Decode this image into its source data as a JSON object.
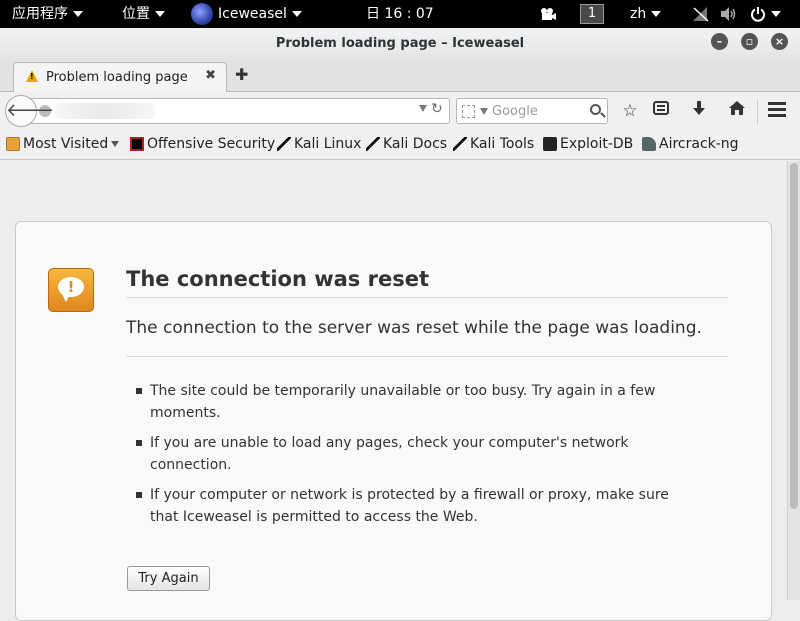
{
  "topbar": {
    "applications": "应用程序",
    "places": "位置",
    "app_name": "Iceweasel",
    "clock": "日 16 : 07",
    "workspace": "1",
    "input_method": "zh"
  },
  "window": {
    "title": "Problem loading page – Iceweasel"
  },
  "tabs": [
    {
      "label": "Problem loading page"
    }
  ],
  "navbar": {
    "search_placeholder": "Google"
  },
  "bookmarks": [
    {
      "label": "Most Visited"
    },
    {
      "label": "Offensive Security"
    },
    {
      "label": "Kali Linux"
    },
    {
      "label": "Kali Docs"
    },
    {
      "label": "Kali Tools"
    },
    {
      "label": "Exploit-DB"
    },
    {
      "label": "Aircrack-ng"
    }
  ],
  "error": {
    "title": "The connection was reset",
    "subtitle": "The connection to the server was reset while the page was loading.",
    "bullets": [
      "The site could be temporarily unavailable or too busy. Try again in a few moments.",
      "If you are unable to load any pages, check your computer's network connection.",
      "If your computer or network is protected by a firewall or proxy, make sure that Iceweasel is permitted to access the Web."
    ],
    "button": "Try Again"
  }
}
